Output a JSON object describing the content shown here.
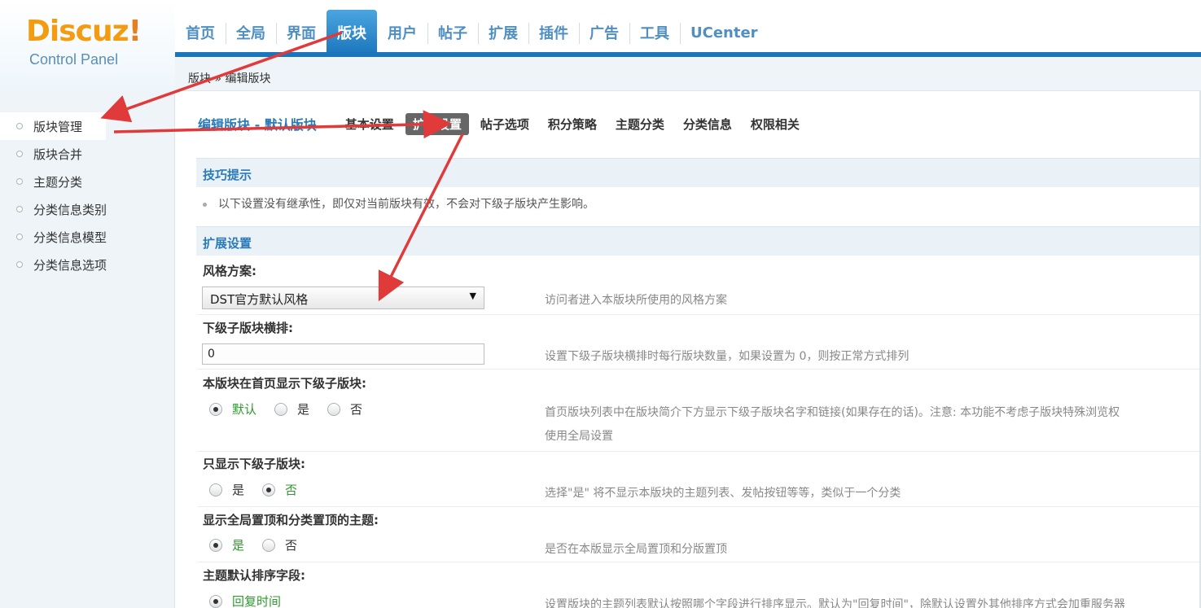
{
  "logo": {
    "brand": "Discuz",
    "bang": "!",
    "subtitle": "Control Panel"
  },
  "topnav": [
    "首页",
    "全局",
    "界面",
    "版块",
    "用户",
    "帖子",
    "扩展",
    "插件",
    "广告",
    "工具",
    "UCenter"
  ],
  "topnav_active_index": 3,
  "breadcrumb": {
    "parent": "版块",
    "sep": "»",
    "current": "编辑版块"
  },
  "sidebar": {
    "items": [
      "版块管理",
      "版块合并",
      "主题分类",
      "分类信息类别",
      "分类信息模型",
      "分类信息选项"
    ],
    "active_index": 0
  },
  "subnav": {
    "title": "编辑版块 - 默认版块",
    "tabs": [
      "基本设置",
      "扩展设置",
      "帖子选项",
      "积分策略",
      "主题分类",
      "分类信息",
      "权限相关"
    ],
    "active_index": 1
  },
  "tips": {
    "heading": "技巧提示",
    "text": "以下设置没有继承性，即仅对当前版块有效，不会对下级子版块产生影响。"
  },
  "settings": {
    "heading": "扩展设置",
    "style_scheme": {
      "label": "风格方案:",
      "value": "DST官方默认风格",
      "desc": "访问者进入本版块所使用的风格方案"
    },
    "sub_columns": {
      "label": "下级子版块横排:",
      "value": "0",
      "desc": "设置下级子版块横排时每行版块数量，如果设置为 0，则按正常方式排列"
    },
    "show_sub_on_index": {
      "label": "本版块在首页显示下级子版块:",
      "options": [
        "默认",
        "是",
        "否"
      ],
      "selected": 0,
      "desc_line1": "首页版块列表中在版块简介下方显示下级子版块名字和链接(如果存在的话)。注意: 本功能不考虑子版块特殊浏览权",
      "desc_line2": "使用全局设置"
    },
    "only_show_sub": {
      "label": "只显示下级子版块:",
      "options": [
        "是",
        "否"
      ],
      "selected": 1,
      "desc": "选择\"是\" 将不显示本版块的主题列表、发帖按钮等等，类似于一个分类"
    },
    "show_global_sticky": {
      "label": "显示全局置顶和分类置顶的主题:",
      "options": [
        "是",
        "否"
      ],
      "selected": 0,
      "desc": "是否在本版显示全局置顶和分版置顶"
    },
    "default_order": {
      "label": "主题默认排序字段:",
      "options": [
        "回复时间"
      ],
      "selected": 0,
      "desc": "设置版块的主题列表默认按照哪个字段进行排序显示。默认为\"回复时间\"，除默认设置外其他排序方式会加重服务器"
    }
  },
  "colors": {
    "accent": "#1b75bc",
    "link": "#2a7ab8",
    "checked": "#2c9a2c",
    "annotation_arrow": "#e03a3a",
    "logo_orange": "#f39c12"
  }
}
